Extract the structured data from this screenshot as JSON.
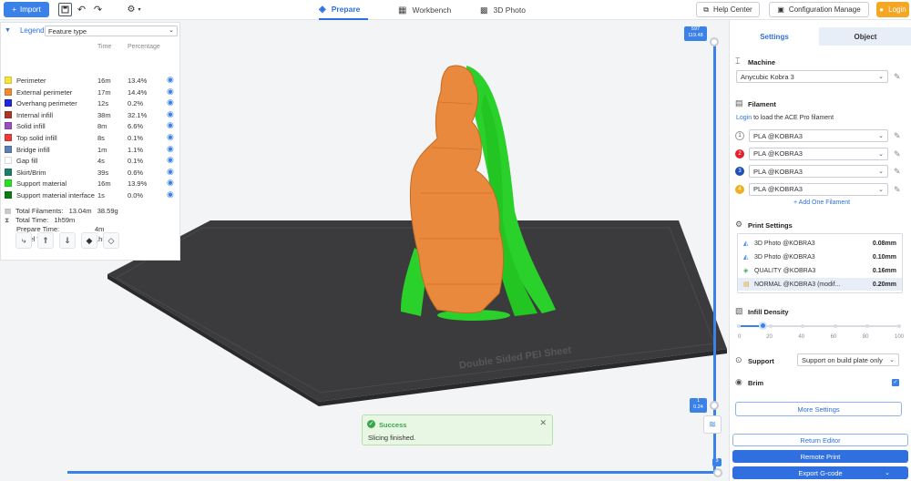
{
  "toolbar": {
    "import_label": "Import",
    "tabs": [
      {
        "label": "Prepare"
      },
      {
        "label": "Workbench"
      },
      {
        "label": "3D Photo"
      }
    ],
    "help_label": "Help Center",
    "config_label": "Configuration Manage",
    "login_label": "Login"
  },
  "legend": {
    "title": "Legend",
    "view_select": "Feature type",
    "col_time": "Time",
    "col_pct": "Percentage",
    "items": [
      {
        "name": "Perimeter",
        "time": "16m",
        "pct": "13.4%",
        "color": "#f8e33a"
      },
      {
        "name": "External perimeter",
        "time": "17m",
        "pct": "14.4%",
        "color": "#ef8a2e"
      },
      {
        "name": "Overhang perimeter",
        "time": "12s",
        "pct": "0.2%",
        "color": "#2026e0"
      },
      {
        "name": "Internal infill",
        "time": "38m",
        "pct": "32.1%",
        "color": "#a8372a"
      },
      {
        "name": "Solid infill",
        "time": "8m",
        "pct": "6.6%",
        "color": "#9a4ec4"
      },
      {
        "name": "Top solid infill",
        "time": "8s",
        "pct": "0.1%",
        "color": "#ee3a3a"
      },
      {
        "name": "Bridge infill",
        "time": "1m",
        "pct": "1.1%",
        "color": "#5c7fb8"
      },
      {
        "name": "Gap fill",
        "time": "4s",
        "pct": "0.1%",
        "color": "#ffffff"
      },
      {
        "name": "Skirt/Brim",
        "time": "39s",
        "pct": "0.6%",
        "color": "#19806a"
      },
      {
        "name": "Support material",
        "time": "16m",
        "pct": "13.9%",
        "color": "#28e024"
      },
      {
        "name": "Support material interface",
        "time": "1s",
        "pct": "0.0%",
        "color": "#0d7d12"
      }
    ],
    "total_filaments_label": "Total Filaments:",
    "total_filaments_len": "13.04m",
    "total_filaments_weight": "38.59g",
    "total_time_label": "Total Time:",
    "total_time": "1h59m",
    "prepare_time_label": "Prepare Time:",
    "prepare_time": "4m",
    "model_time_label": "Model Time:",
    "model_time": "1h55m"
  },
  "layer_slider": {
    "top_layer": "597",
    "top_height": "119.48",
    "bottom_layer": "1",
    "bottom_height": "0.24",
    "move_value": "3"
  },
  "plate": {
    "label": "Double Sided PEI Sheet"
  },
  "toast": {
    "title": "Success",
    "message": "Slicing finished."
  },
  "right_panel": {
    "tab_settings": "Settings",
    "tab_object": "Object",
    "machine_title": "Machine",
    "machine_value": "Anycubic Kobra 3",
    "filament_title": "Filament",
    "login_link": "Login",
    "login_rest": " to load the ACE Pro filament",
    "filaments": [
      {
        "num": "1",
        "name": "PLA @KOBRA3",
        "color": "#ffffff"
      },
      {
        "num": "2",
        "name": "PLA @KOBRA3",
        "color": "#e0202a"
      },
      {
        "num": "3",
        "name": "PLA @KOBRA3",
        "color": "#1d4fb8"
      },
      {
        "num": "4",
        "name": "PLA @KOBRA3",
        "color": "#f0b020"
      }
    ],
    "add_filament": "+ Add One Filament",
    "print_settings_title": "Print Settings",
    "print_settings": [
      {
        "name": "3D Photo @KOBRA3",
        "value": "0.08mm"
      },
      {
        "name": "3D Photo @KOBRA3",
        "value": "0.10mm"
      },
      {
        "name": "QUALITY @KOBRA3",
        "value": "0.16mm"
      },
      {
        "name": "NORMAL @KOBRA3 (modif...",
        "value": "0.20mm"
      }
    ],
    "infill_title": "Infill Density",
    "infill_value": 15,
    "infill_ticks": [
      "0",
      "20",
      "40",
      "60",
      "80",
      "100"
    ],
    "support_title": "Support",
    "support_value": "Support on build plate only",
    "brim_title": "Brim",
    "brim_checked": true,
    "more_settings": "More Settings",
    "return_editor": "Return Editor",
    "remote_print": "Remote Print",
    "export_gcode": "Export G-code"
  }
}
